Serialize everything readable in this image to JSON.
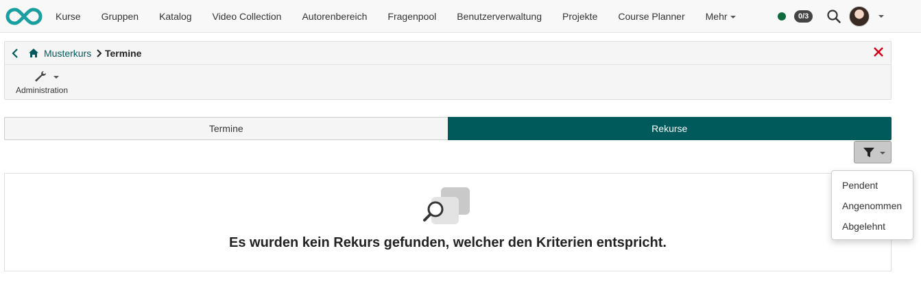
{
  "nav": {
    "items": [
      "Kurse",
      "Gruppen",
      "Katalog",
      "Video Collection",
      "Autorenbereich",
      "Fragenpool",
      "Benutzerverwaltung",
      "Projekte",
      "Course Planner"
    ],
    "more_label": "Mehr",
    "badge": "0/3",
    "status_color": "#0c6a3c"
  },
  "breadcrumb": {
    "home_label": "Musterkurs",
    "current": "Termine"
  },
  "toolbar": {
    "admin_label": "Administration"
  },
  "tabs": [
    {
      "label": "Termine",
      "active": false
    },
    {
      "label": "Rekurse",
      "active": true
    }
  ],
  "filter_menu": {
    "options": [
      "Pendent",
      "Angenommen",
      "Abgelehnt"
    ]
  },
  "empty_state": {
    "message": "Es wurden kein Rekurs gefunden, welcher den Kriterien entspricht."
  },
  "colors": {
    "accent": "#00595a",
    "close": "#d0021b"
  },
  "icons": [
    "logo-infinity-icon",
    "search-icon",
    "chevron-left-icon",
    "home-icon",
    "chevron-right-icon",
    "close-icon",
    "wrench-icon",
    "funnel-icon",
    "empty-search-icon"
  ]
}
